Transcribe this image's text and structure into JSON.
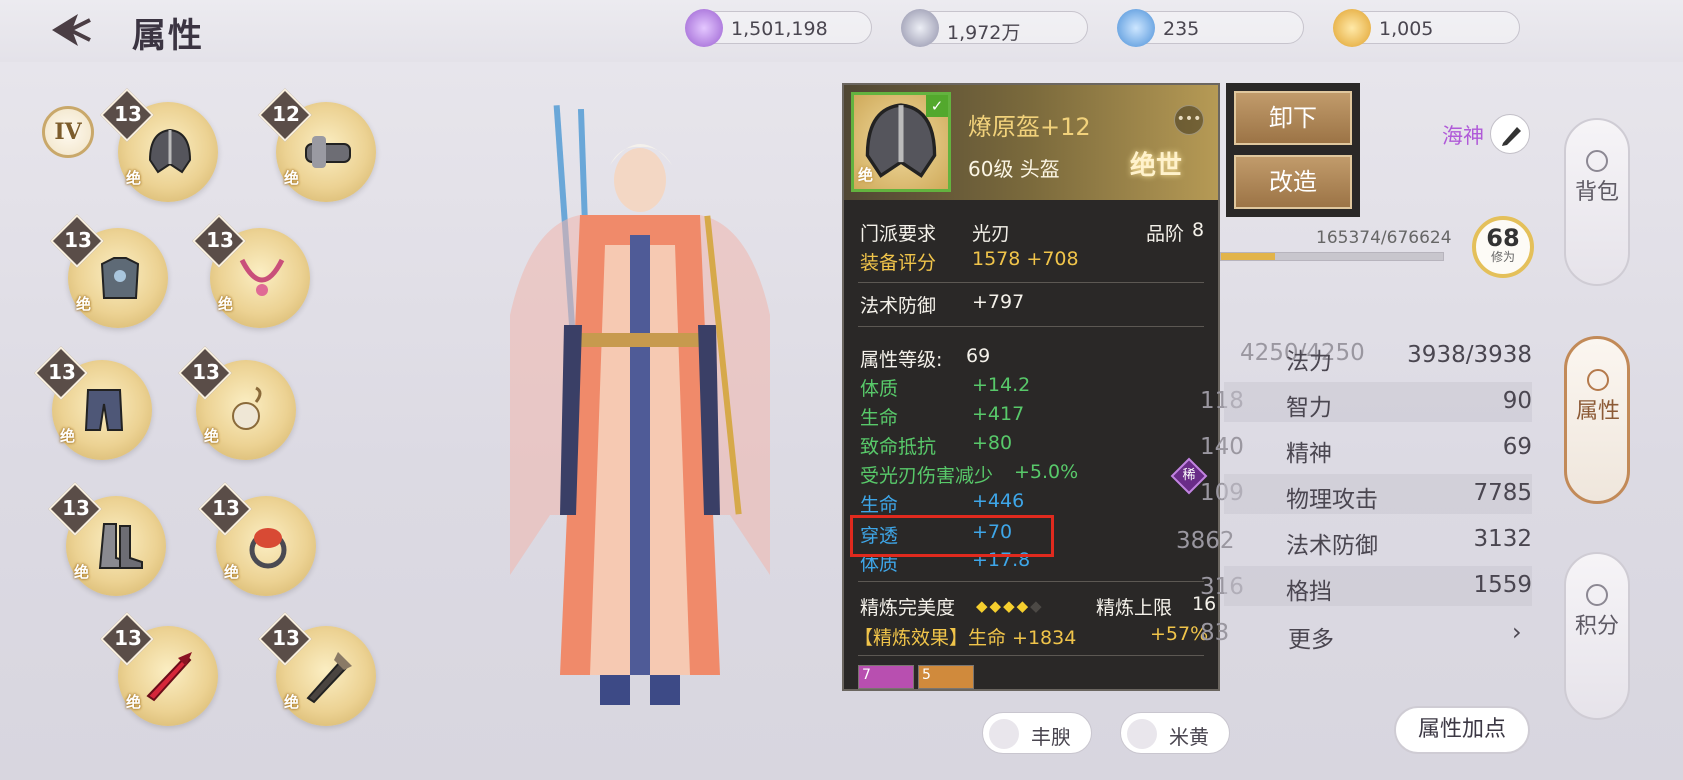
{
  "header": {
    "title": "属性",
    "back_icon": "back-arrow-icon",
    "currencies": [
      {
        "icon": "purple-gem-icon",
        "value": "1,501,198",
        "color": "#a36bd6"
      },
      {
        "icon": "silver-coin-icon",
        "value": "1,972万",
        "color": "#8f8fa8"
      },
      {
        "icon": "blue-orb-icon",
        "value": "235",
        "color": "#4a8fd8"
      },
      {
        "icon": "gold-coin-icon",
        "value": "1,005",
        "color": "#e0a12c"
      }
    ]
  },
  "tier": "IV",
  "equipment": [
    {
      "level": "13",
      "grade": "绝",
      "icon": "helmet-icon"
    },
    {
      "level": "12",
      "grade": "绝",
      "icon": "gauntlet-icon"
    },
    {
      "level": "13",
      "grade": "绝",
      "icon": "armor-icon"
    },
    {
      "level": "13",
      "grade": "绝",
      "icon": "necklace-icon"
    },
    {
      "level": "13",
      "grade": "绝",
      "icon": "pants-icon"
    },
    {
      "level": "13",
      "grade": "绝",
      "icon": "pendant-icon"
    },
    {
      "level": "13",
      "grade": "绝",
      "icon": "boots-icon"
    },
    {
      "level": "13",
      "grade": "绝",
      "icon": "ring-icon"
    },
    {
      "level": "13",
      "grade": "绝",
      "icon": "sword-icon"
    },
    {
      "level": "13",
      "grade": "绝",
      "icon": "weapon-icon"
    }
  ],
  "tooltip": {
    "name": "燎原盔+12",
    "sub": "60级  头盔",
    "rank": "绝世",
    "grade_mark": "绝",
    "sect_label": "门派要求",
    "sect_value": "光刃",
    "quality_label": "品阶",
    "quality_value": "8",
    "score_label": "装备评分",
    "score_value": "1578 +708",
    "mdef_label": "法术防御",
    "mdef_value": "+797",
    "attr_level_label": "属性等级:",
    "attr_level_value": "69",
    "attrs": [
      {
        "name": "体质",
        "value": "+14.2"
      },
      {
        "name": "生命",
        "value": "+417"
      },
      {
        "name": "致命抵抗",
        "value": "+80"
      },
      {
        "name": "受光刃伤害减少",
        "value": "+5.0%"
      },
      {
        "name": "生命",
        "value": "+446"
      },
      {
        "name": "穿透",
        "value": "+70"
      },
      {
        "name": "体质",
        "value": "+17.8"
      }
    ],
    "rare_mark": "稀",
    "refine_perfect_label": "精炼完美度",
    "refine_level": 3.5,
    "refine_level_max": 5,
    "refine_limit_label": "精炼上限",
    "refine_limit_value": "16",
    "refine_effect_label": "【精炼效果】生命 +1834",
    "refine_effect_pct": "+57%",
    "gems": [
      {
        "count": "7",
        "color": "#b84fb0"
      },
      {
        "count": "5",
        "color": "#d08a3c"
      }
    ]
  },
  "actions": {
    "unequip": "卸下",
    "modify": "改造"
  },
  "stats_panel": {
    "name": "海神",
    "exp": "165374/676624",
    "exp_ratio": 0.244,
    "cultivation": "68",
    "cultivation_label": "修为",
    "rows": [
      {
        "name": "法力",
        "value": "3938/3938"
      },
      {
        "name": "智力",
        "value": "90"
      },
      {
        "name": "精神",
        "value": "69"
      },
      {
        "name": "物理攻击",
        "value": "7785"
      },
      {
        "name": "法术防御",
        "value": "3132"
      },
      {
        "name": "格挡",
        "value": "1559"
      }
    ],
    "more": "更多",
    "ghost": {
      "hp": "4250/4250",
      "r2": "118",
      "r3": "140",
      "r4": "109",
      "r5": "3862",
      "r6": "316",
      "r7": "83"
    }
  },
  "side_tabs": [
    {
      "label": "背包",
      "icon": "backpack-icon"
    },
    {
      "label": "属性",
      "icon": "attribute-icon"
    },
    {
      "label": "积分",
      "icon": "points-icon"
    }
  ],
  "bottom": {
    "btn1": "丰腴",
    "btn2": "米黄",
    "alloc": "属性加点"
  }
}
